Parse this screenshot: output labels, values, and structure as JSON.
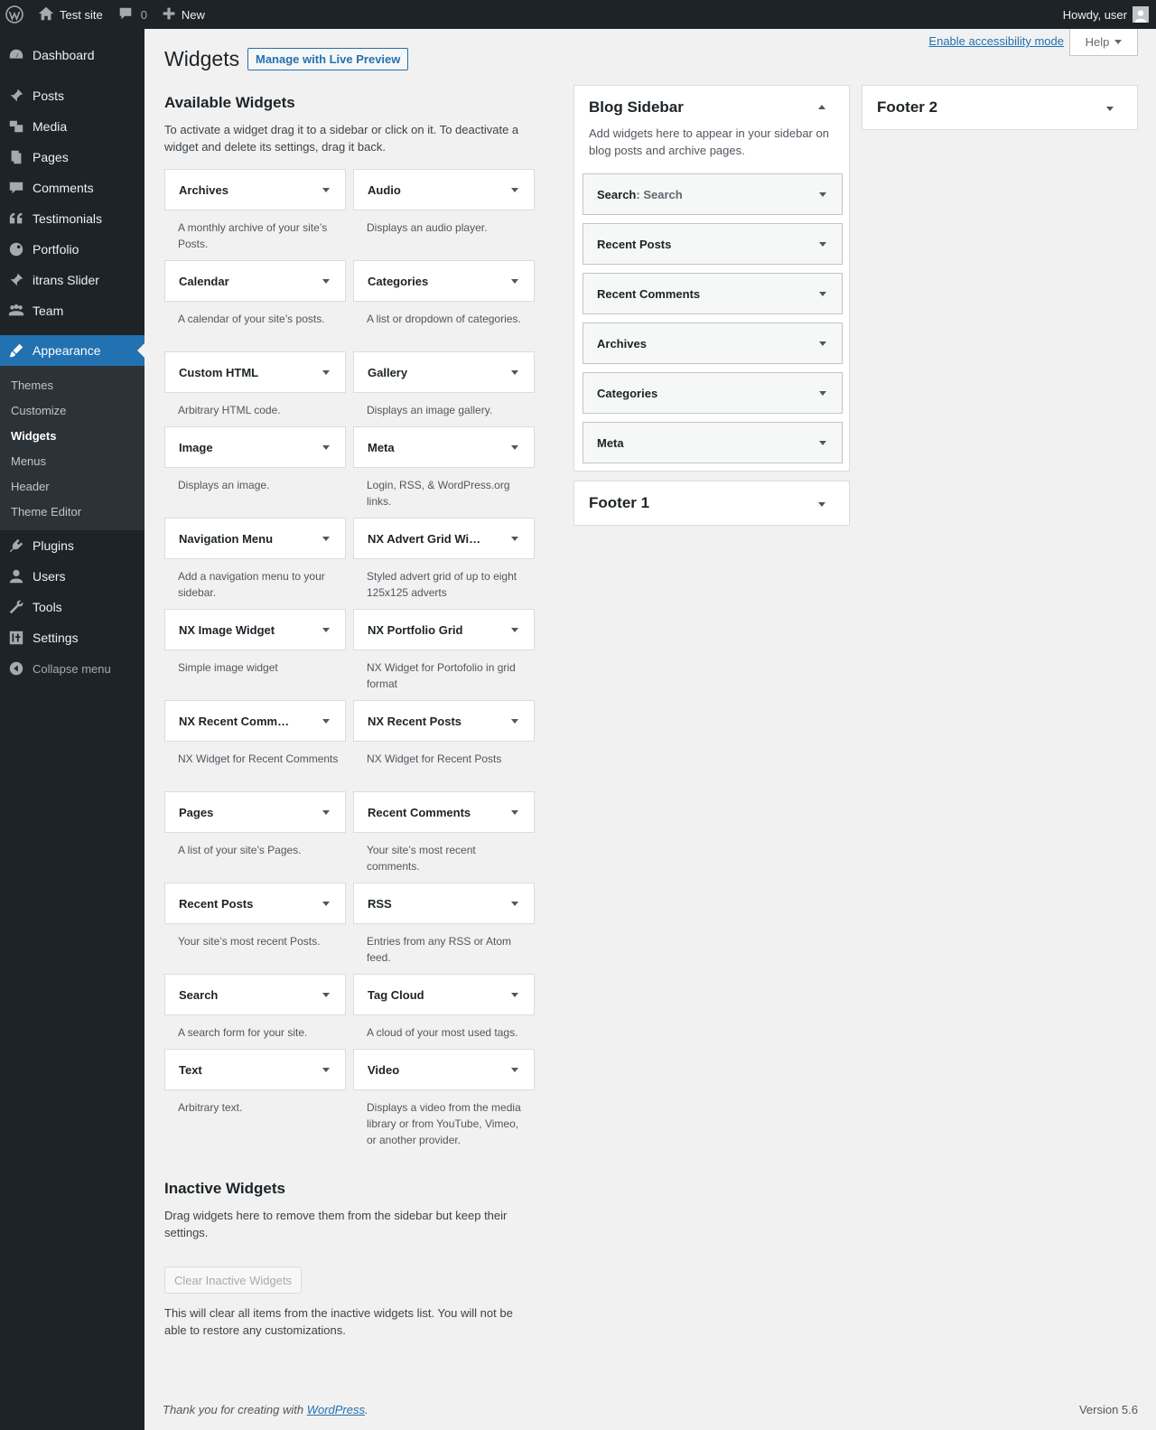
{
  "adminbar": {
    "site_name": "Test site",
    "comments_count": "0",
    "new_label": "New",
    "howdy": "Howdy, user"
  },
  "menu": {
    "items_top": [
      {
        "label": "Dashboard",
        "icon": "dashboard-icon"
      }
    ],
    "items_mid": [
      {
        "label": "Posts",
        "icon": "pin-icon"
      },
      {
        "label": "Media",
        "icon": "media-icon"
      },
      {
        "label": "Pages",
        "icon": "pages-icon"
      },
      {
        "label": "Comments",
        "icon": "comment-icon"
      },
      {
        "label": "Testimonials",
        "icon": "quote-icon"
      },
      {
        "label": "Portfolio",
        "icon": "portfolio-icon"
      },
      {
        "label": "itrans Slider",
        "icon": "pin-icon"
      },
      {
        "label": "Team",
        "icon": "team-icon"
      }
    ],
    "appearance": "Appearance",
    "submenu": [
      "Themes",
      "Customize",
      "Widgets",
      "Menus",
      "Header",
      "Theme Editor"
    ],
    "items_bottom": [
      {
        "label": "Plugins",
        "icon": "plugin-icon"
      },
      {
        "label": "Users",
        "icon": "user-icon"
      },
      {
        "label": "Tools",
        "icon": "wrench-icon"
      },
      {
        "label": "Settings",
        "icon": "settings-icon"
      }
    ],
    "collapse": "Collapse menu"
  },
  "header": {
    "a11y_link": "Enable accessibility mode",
    "help": "Help",
    "title": "Widgets",
    "preview_button": "Manage with Live Preview"
  },
  "available": {
    "title": "Available Widgets",
    "description": "To activate a widget drag it to a sidebar or click on it. To deactivate a widget and delete its settings, drag it back.",
    "widgets": [
      {
        "name": "Archives",
        "desc": "A monthly archive of your site’s Posts."
      },
      {
        "name": "Audio",
        "desc": "Displays an audio player."
      },
      {
        "name": "Calendar",
        "desc": "A calendar of your site’s posts."
      },
      {
        "name": "Categories",
        "desc": "A list or dropdown of categories."
      },
      {
        "name": "Custom HTML",
        "desc": "Arbitrary HTML code."
      },
      {
        "name": "Gallery",
        "desc": "Displays an image gallery."
      },
      {
        "name": "Image",
        "desc": "Displays an image."
      },
      {
        "name": "Meta",
        "desc": "Login, RSS, & WordPress.org links."
      },
      {
        "name": "Navigation Menu",
        "desc": "Add a navigation menu to your sidebar."
      },
      {
        "name": "NX Advert Grid Wi…",
        "desc": "Styled advert grid of up to eight 125x125 adverts"
      },
      {
        "name": "NX Image Widget",
        "desc": "Simple image widget"
      },
      {
        "name": "NX Portfolio Grid",
        "desc": "NX Widget for Portofolio in grid format"
      },
      {
        "name": "NX Recent Comm…",
        "desc": "NX Widget for Recent Comments"
      },
      {
        "name": "NX Recent Posts",
        "desc": "NX Widget for Recent Posts"
      },
      {
        "name": "Pages",
        "desc": "A list of your site’s Pages."
      },
      {
        "name": "Recent Comments",
        "desc": "Your site’s most recent comments."
      },
      {
        "name": "Recent Posts",
        "desc": "Your site’s most recent Posts."
      },
      {
        "name": "RSS",
        "desc": "Entries from any RSS or Atom feed."
      },
      {
        "name": "Search",
        "desc": "A search form for your site."
      },
      {
        "name": "Tag Cloud",
        "desc": "A cloud of your most used tags."
      },
      {
        "name": "Text",
        "desc": "Arbitrary text."
      },
      {
        "name": "Video",
        "desc": "Displays a video from the media library or from YouTube, Vimeo, or another provider."
      }
    ]
  },
  "inactive": {
    "title": "Inactive Widgets",
    "description": "Drag widgets here to remove them from the sidebar but keep their settings.",
    "clear_button": "Clear Inactive Widgets",
    "clear_description": "This will clear all items from the inactive widgets list. You will not be able to restore any customizations."
  },
  "sidebars": {
    "blog": {
      "title": "Blog Sidebar",
      "description": "Add widgets here to appear in your sidebar on blog posts and archive pages.",
      "widgets": [
        {
          "name": "Search",
          "instance": ": Search"
        },
        {
          "name": "Recent Posts",
          "instance": ""
        },
        {
          "name": "Recent Comments",
          "instance": ""
        },
        {
          "name": "Archives",
          "instance": ""
        },
        {
          "name": "Categories",
          "instance": ""
        },
        {
          "name": "Meta",
          "instance": ""
        }
      ]
    },
    "footer1": {
      "title": "Footer 1"
    },
    "footer2": {
      "title": "Footer 2"
    }
  },
  "footer": {
    "thanks_prefix": "Thank you for creating with ",
    "wp_link": "WordPress",
    "thanks_suffix": ".",
    "version": "Version 5.6"
  }
}
